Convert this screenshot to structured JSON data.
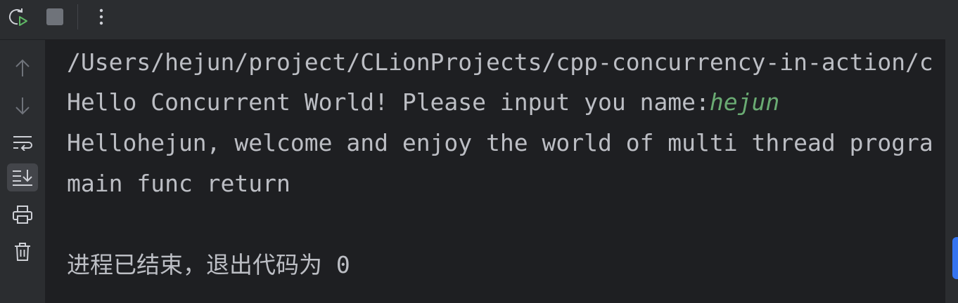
{
  "toolbar": {
    "rerun_icon": "rerun-icon",
    "stop_icon": "stop-icon",
    "more_icon": "more-vertical-icon"
  },
  "sidebar": {
    "icons": [
      "arrow-up-icon",
      "arrow-down-icon",
      "soft-wrap-icon",
      "scroll-to-end-icon",
      "print-icon",
      "trash-icon"
    ],
    "active": "scroll-to-end-icon"
  },
  "console": {
    "lines": [
      "/Users/hejun/project/CLionProjects/cpp-concurrency-in-action/c",
      "Hello Concurrent World! Please input you name:",
      "Hellohejun, welcome and enjoy the world of multi thread progra",
      "main func return",
      "",
      "进程已结束，退出代码为 0"
    ],
    "user_input": "hejun"
  },
  "colors": {
    "background": "#1e1f22",
    "panel": "#2b2d30",
    "text": "#bcbec4",
    "input_text": "#6aab73",
    "accent": "#3574f0"
  }
}
